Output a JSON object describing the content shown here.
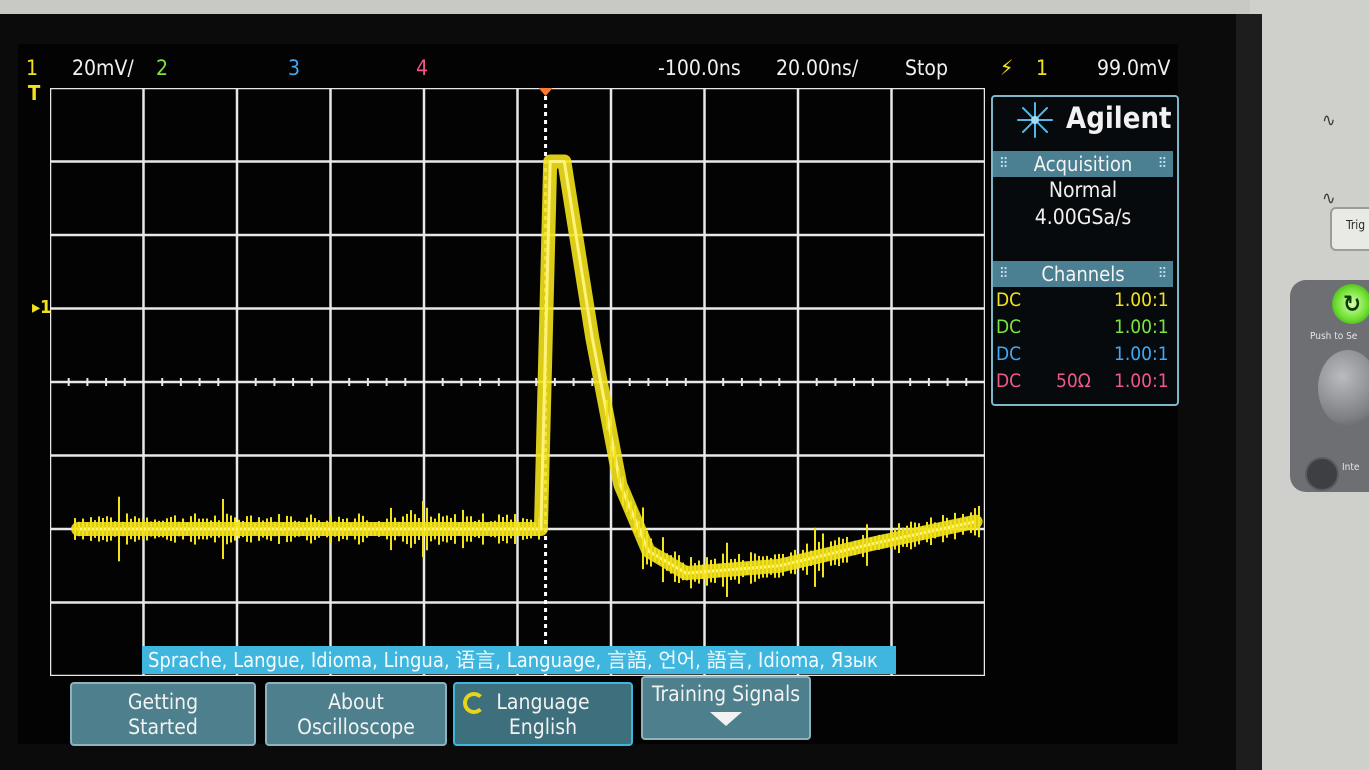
{
  "status_bar": {
    "ch1_label": "1",
    "ch1_scale": "20mV/",
    "ch2_label": "2",
    "ch3_label": "3",
    "ch4_label": "4",
    "time_delay": "-100.0ns",
    "time_scale": "20.00ns/",
    "run_state": "Stop",
    "trigger_source": "1",
    "trigger_level": "99.0mV"
  },
  "markers": {
    "trigger_level_marker": "T",
    "ch1_ground_marker": "1"
  },
  "panel": {
    "brand": "Agilent",
    "acquisition_title": "Acquisition",
    "acquisition_mode": "Normal",
    "sample_rate": "4.00GSa/s",
    "channels_title": "Channels",
    "channels": [
      {
        "coupling": "DC",
        "impedance": "",
        "probe": "1.00:1",
        "color": "#f2e21a"
      },
      {
        "coupling": "DC",
        "impedance": "",
        "probe": "1.00:1",
        "color": "#7be53b"
      },
      {
        "coupling": "DC",
        "impedance": "",
        "probe": "1.00:1",
        "color": "#3fa9f5"
      },
      {
        "coupling": "DC",
        "impedance": "50Ω",
        "probe": "1.00:1",
        "color": "#f2578a"
      }
    ]
  },
  "language_banner": "Sprache, Langue, Idioma, Lingua, 语言, Language, 言語, 언어, 語言, Idioma, Язык",
  "softkeys": {
    "getting_started_l1": "Getting",
    "getting_started_l2": "Started",
    "about_l1": "About",
    "about_l2": "Oscilloscope",
    "language_l1": "Language",
    "language_l2": "English",
    "training_l1": "Training Signals"
  },
  "front_panel": {
    "push_label": "Push to Se",
    "trig_label": "Trig",
    "side_label": "Inte"
  },
  "colors": {
    "ch1": "#f2e21a",
    "ch2": "#7be53b",
    "ch3": "#3fa9f5",
    "ch4": "#f2578a",
    "accent": "#3fb6dd",
    "trigger_marker": "#ff7a2a"
  },
  "trace": {
    "channel": 1,
    "description_points": [
      {
        "t_div": -5.0,
        "v_div": -2.0
      },
      {
        "t_div": -0.05,
        "v_div": -2.0
      },
      {
        "t_div": 0.05,
        "v_div": 3.0
      },
      {
        "t_div": 0.2,
        "v_div": 3.0
      },
      {
        "t_div": 0.5,
        "v_div": 0.6
      },
      {
        "t_div": 0.8,
        "v_div": -1.4
      },
      {
        "t_div": 1.1,
        "v_div": -2.3
      },
      {
        "t_div": 1.5,
        "v_div": -2.6
      },
      {
        "t_div": 2.5,
        "v_div": -2.5
      },
      {
        "t_div": 3.5,
        "v_div": -2.2
      },
      {
        "t_div": 4.6,
        "v_div": -1.9
      }
    ]
  }
}
